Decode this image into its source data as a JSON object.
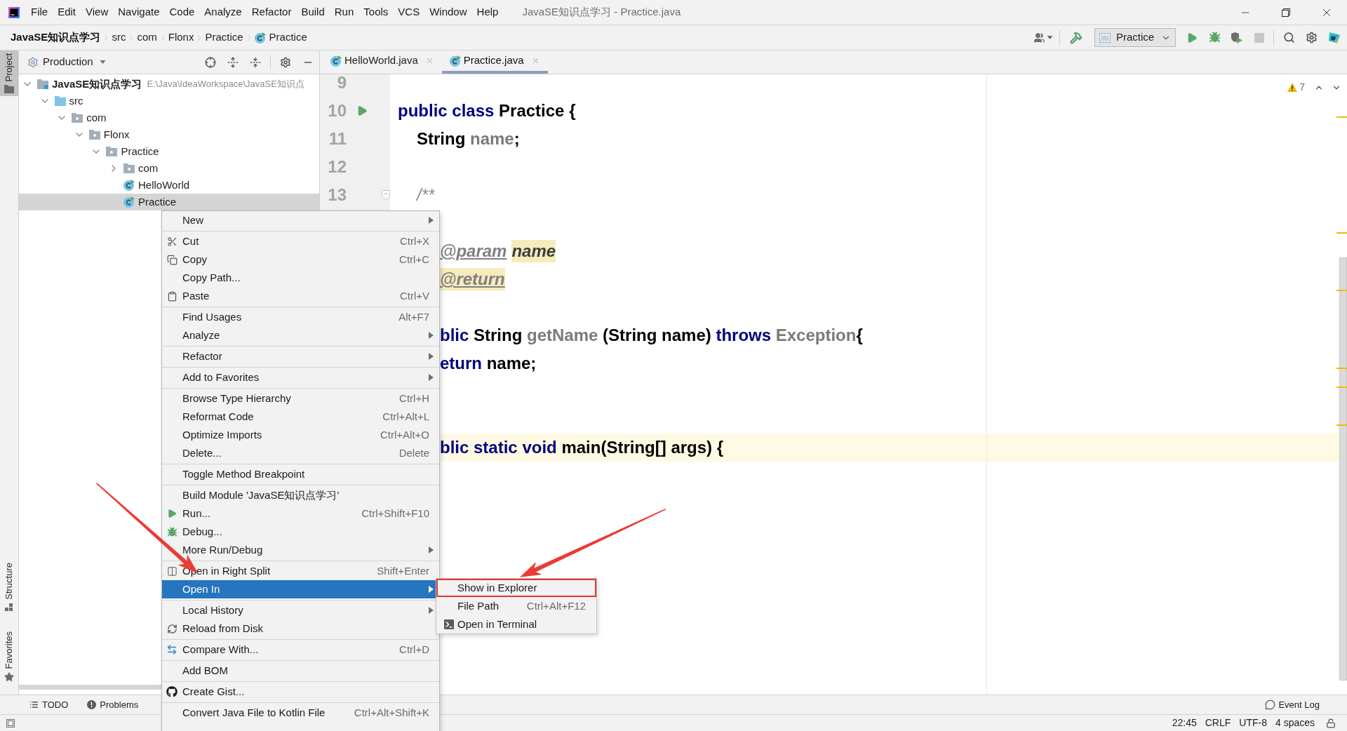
{
  "menu_bar": {
    "items": [
      "File",
      "Edit",
      "View",
      "Navigate",
      "Code",
      "Analyze",
      "Refactor",
      "Build",
      "Run",
      "Tools",
      "VCS",
      "Window",
      "Help"
    ],
    "title": "JavaSE知识点学习 - Practice.java"
  },
  "breadcrumbs": [
    {
      "label": "JavaSE知识点学习",
      "kind": "project"
    },
    {
      "label": "src",
      "kind": "folder"
    },
    {
      "label": "com",
      "kind": "folder"
    },
    {
      "label": "Flonx",
      "kind": "folder"
    },
    {
      "label": "Practice",
      "kind": "folder"
    },
    {
      "label": "Practice",
      "kind": "class"
    }
  ],
  "toolbar": {
    "run_configuration": "Practice"
  },
  "tool_stripe": [
    {
      "label": "Project",
      "selected": true
    },
    {
      "label": "Structure",
      "selected": false
    },
    {
      "label": "Favorites",
      "selected": false
    }
  ],
  "project_panel": {
    "view": "Production",
    "tree": [
      {
        "label": "JavaSE知识点学习",
        "path": "E:\\Java\\IdeaWorkspace\\JavaSE知识点",
        "kind": "module",
        "expanded": true,
        "selected": false,
        "children": [
          {
            "label": "src",
            "kind": "source_folder",
            "expanded": true,
            "selected": false,
            "children": [
              {
                "label": "com",
                "kind": "package",
                "expanded": true,
                "selected": false,
                "children": [
                  {
                    "label": "Flonx",
                    "kind": "package",
                    "expanded": true,
                    "selected": false,
                    "children": [
                      {
                        "label": "Practice",
                        "kind": "package",
                        "expanded": true,
                        "selected": false,
                        "children": [
                          {
                            "label": "com",
                            "kind": "package",
                            "expanded": false,
                            "selected": false
                          },
                          {
                            "label": "HelloWorld",
                            "kind": "class",
                            "selected": false
                          },
                          {
                            "label": "Practice",
                            "kind": "class",
                            "selected": true
                          }
                        ]
                      }
                    ]
                  }
                ]
              }
            ]
          }
        ]
      }
    ]
  },
  "editor": {
    "tabs": [
      {
        "label": "HelloWorld.java",
        "selected": false
      },
      {
        "label": "Practice.java",
        "selected": true
      }
    ],
    "warning_count": "7",
    "lines": [
      {
        "number": "9",
        "current": false
      },
      {
        "number": "10",
        "marker": {
          "kind": "run"
        },
        "current": false,
        "kind": "plain",
        "tokens": [
          {
            "text": "public class",
            "kind": "keyword",
            "highlighted": false
          },
          {
            "text": " Practice {",
            "kind": "plain",
            "highlighted": false
          }
        ]
      },
      {
        "number": "11",
        "current": false,
        "kind": "indented",
        "tokens": [
          {
            "text": "String",
            "kind": "plain",
            "highlighted": false
          },
          {
            "text": " name",
            "kind": "muted",
            "highlighted": false
          },
          {
            "text": ";",
            "kind": "plain",
            "highlighted": false
          }
        ]
      },
      {
        "number": "12",
        "current": false
      },
      {
        "number": "13",
        "marker": {
          "kind": "fold"
        },
        "current": false,
        "kind": "indented",
        "tokens": [
          {
            "text": "/**",
            "kind": "comment",
            "highlighted": false
          }
        ]
      },
      {
        "current": false
      },
      {
        "current": false,
        "kind": "covered",
        "tokens": [
          {
            "text": "@param",
            "kind": "doc_tag",
            "highlighted": false
          },
          {
            "text": "name",
            "kind": "doc_param",
            "highlighted": true
          }
        ]
      },
      {
        "current": false,
        "kind": "covered",
        "tokens": [
          {
            "text": "@return",
            "kind": "doc_tag",
            "highlighted": true
          }
        ]
      },
      {
        "current": false
      },
      {
        "current": false,
        "kind": "covered",
        "tokens": [
          {
            "text": "blic",
            "kind": "keyword",
            "highlighted": false
          },
          {
            "text": " String ",
            "kind": "plain",
            "highlighted": false
          },
          {
            "text": "getName",
            "kind": "muted",
            "highlighted": false
          },
          {
            "text": " (String name) ",
            "kind": "plain",
            "highlighted": false
          },
          {
            "text": "throws",
            "kind": "keyword",
            "highlighted": false
          },
          {
            "text": " Exception",
            "kind": "muted",
            "highlighted": false
          },
          {
            "text": "{",
            "kind": "plain",
            "highlighted": false
          }
        ]
      },
      {
        "current": false,
        "kind": "covered",
        "tokens": [
          {
            "text": "eturn",
            "kind": "keyword",
            "highlighted": false
          },
          {
            "text": " name;",
            "kind": "plain",
            "highlighted": false
          }
        ]
      },
      {
        "current": false
      },
      {
        "current": false
      },
      {
        "current": true,
        "kind": "covered",
        "tokens": [
          {
            "text": "blic static void",
            "kind": "keyword",
            "highlighted": false
          },
          {
            "text": " main(String[] args) {",
            "kind": "plain",
            "highlighted": false
          }
        ]
      }
    ]
  },
  "context_menu": {
    "groups": [
      {
        "items": [
          {
            "label": "New",
            "submenu": true,
            "selected": false
          }
        ]
      },
      {
        "items": [
          {
            "label": "Cut",
            "shortcut": "Ctrl+X",
            "submenu": false,
            "selected": false
          },
          {
            "label": "Copy",
            "shortcut": "Ctrl+C",
            "submenu": false,
            "selected": false
          },
          {
            "label": "Copy Path...",
            "submenu": false,
            "selected": false
          },
          {
            "label": "Paste",
            "shortcut": "Ctrl+V",
            "submenu": false,
            "selected": false
          }
        ]
      },
      {
        "items": [
          {
            "label": "Find Usages",
            "shortcut": "Alt+F7",
            "submenu": false,
            "selected": false
          },
          {
            "label": "Analyze",
            "submenu": true,
            "selected": false
          }
        ]
      },
      {
        "items": [
          {
            "label": "Refactor",
            "submenu": true,
            "selected": false
          }
        ]
      },
      {
        "items": [
          {
            "label": "Add to Favorites",
            "submenu": true,
            "selected": false
          }
        ]
      },
      {
        "items": [
          {
            "label": "Browse Type Hierarchy",
            "shortcut": "Ctrl+H",
            "submenu": false,
            "selected": false
          },
          {
            "label": "Reformat Code",
            "shortcut": "Ctrl+Alt+L",
            "submenu": false,
            "selected": false
          },
          {
            "label": "Optimize Imports",
            "shortcut": "Ctrl+Alt+O",
            "submenu": false,
            "selected": false
          },
          {
            "label": "Delete...",
            "shortcut": "Delete",
            "submenu": false,
            "selected": false
          }
        ]
      },
      {
        "items": [
          {
            "label": "Toggle Method Breakpoint",
            "submenu": false,
            "selected": false
          }
        ]
      },
      {
        "items": [
          {
            "label": "Build Module 'JavaSE知识点学习'",
            "submenu": false,
            "selected": false
          },
          {
            "label": "Run...",
            "shortcut": "Ctrl+Shift+F10",
            "submenu": false,
            "selected": false
          },
          {
            "label": "Debug...",
            "submenu": false,
            "selected": false
          },
          {
            "label": "More Run/Debug",
            "submenu": true,
            "selected": false
          }
        ]
      },
      {
        "items": [
          {
            "label": "Open in Right Split",
            "shortcut": "Shift+Enter",
            "submenu": false,
            "selected": false
          },
          {
            "label": "Open In",
            "submenu": true,
            "selected": true
          }
        ]
      },
      {
        "items": [
          {
            "label": "Local History",
            "submenu": true,
            "selected": false
          },
          {
            "label": "Reload from Disk",
            "submenu": false,
            "selected": false
          }
        ]
      },
      {
        "items": [
          {
            "label": "Compare With...",
            "shortcut": "Ctrl+D",
            "submenu": false,
            "selected": false
          }
        ]
      },
      {
        "items": [
          {
            "label": "Add BOM",
            "submenu": false,
            "selected": false
          }
        ]
      },
      {
        "items": [
          {
            "label": "Create Gist...",
            "submenu": false,
            "selected": false
          }
        ]
      },
      {
        "items": [
          {
            "label": "Convert Java File to Kotlin File",
            "shortcut": "Ctrl+Alt+Shift+K",
            "submenu": false,
            "selected": false
          }
        ]
      }
    ]
  },
  "submenu": {
    "items": [
      {
        "label": "Show in Explorer",
        "outlined": true
      },
      {
        "label": "File Path",
        "shortcut": "Ctrl+Alt+F12",
        "outlined": false
      },
      {
        "label": "Open in Terminal",
        "outlined": false
      }
    ]
  },
  "tool_window_bar": {
    "items": [
      {
        "label": "TODO"
      },
      {
        "label": "Problems"
      }
    ],
    "event_log": "Event Log"
  },
  "status_bar": {
    "items": [
      "22:45",
      "CRLF",
      "UTF-8",
      "4 spaces"
    ]
  }
}
